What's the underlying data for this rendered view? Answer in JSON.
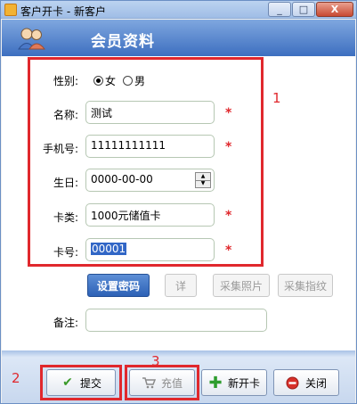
{
  "window": {
    "title": "客户开卡 - 新客户",
    "minimize": "_",
    "maximize": "□",
    "close": "X"
  },
  "header": {
    "title": "会员资料"
  },
  "annotations": {
    "box1": "1",
    "box2": "2",
    "box3": "3"
  },
  "form": {
    "gender": {
      "label": "性别:",
      "options": [
        "女",
        "男"
      ],
      "selected": "女"
    },
    "name": {
      "label": "名称:",
      "value": "测试"
    },
    "phone": {
      "label": "手机号:",
      "value": "11111111111"
    },
    "birthday": {
      "label": "生日:",
      "value": "0000-00-00"
    },
    "card_type": {
      "label": "卡类:",
      "value": "1000元储值卡"
    },
    "card_no": {
      "label": "卡号:",
      "value": "00001"
    },
    "required_mark": "*",
    "remark": {
      "label": "备注:",
      "value": ""
    }
  },
  "form_buttons": {
    "set_password": "设置密码",
    "detail": "详",
    "capture_photo": "采集照片",
    "capture_fingerprint": "采集指纹"
  },
  "actions": {
    "submit": "提交",
    "recharge": "充值",
    "new_card": "新开卡",
    "close": "关闭"
  },
  "colors": {
    "annotation_red": "#e0282d",
    "banner_blue": "#3d6fc0",
    "button_blue": "#2d61b6"
  }
}
